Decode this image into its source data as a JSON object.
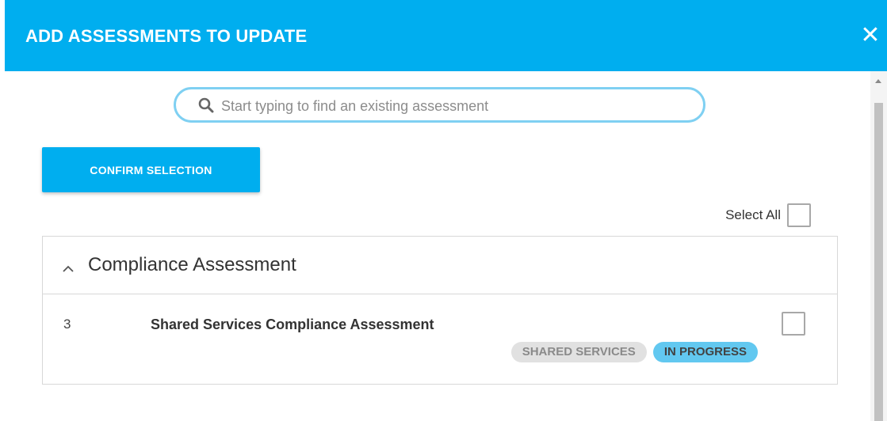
{
  "dialog": {
    "title": "ADD ASSESSMENTS TO UPDATE",
    "close_icon": "close-icon",
    "accent_color": "#00aeef"
  },
  "search": {
    "placeholder": "Start typing to find an existing assessment",
    "value": "",
    "icon": "search-icon"
  },
  "actions": {
    "confirm_label": "CONFIRM SELECTION"
  },
  "select_all": {
    "label": "Select All",
    "checked": false
  },
  "groups": [
    {
      "title": "Compliance Assessment",
      "expanded": true,
      "toggle_icon": "chevron-up-icon",
      "items": [
        {
          "id": "3",
          "title": "Shared Services Compliance Assessment",
          "checked": false,
          "badges": [
            {
              "label": "SHARED SERVICES",
              "color": "#e1e1e1"
            },
            {
              "label": "IN PROGRESS",
              "color": "#62c8f0"
            }
          ]
        }
      ]
    }
  ]
}
